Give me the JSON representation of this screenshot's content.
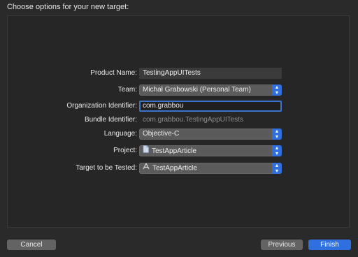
{
  "header": {
    "title": "Choose options for your new target:"
  },
  "form": {
    "product_name": {
      "label": "Product Name:",
      "value": "TestingAppUITests"
    },
    "team": {
      "label": "Team:",
      "value": "Michał Grabowski (Personal Team)"
    },
    "org_identifier": {
      "label": "Organization Identifier:",
      "value": "com.grabbou"
    },
    "bundle_identifier": {
      "label": "Bundle Identifier:",
      "value": "com.grabbou.TestingAppUITests"
    },
    "language": {
      "label": "Language:",
      "value": "Objective-C"
    },
    "project": {
      "label": "Project:",
      "value": "TestAppArticle",
      "icon": "document-icon"
    },
    "target": {
      "label": "Target to be Tested:",
      "value": "TestAppArticle",
      "icon": "app-target-icon"
    }
  },
  "buttons": {
    "cancel": "Cancel",
    "previous": "Previous",
    "finish": "Finish"
  },
  "colors": {
    "accent": "#2f6fe0",
    "focus_ring": "#3d74c9",
    "background": "#2a2a2a"
  }
}
